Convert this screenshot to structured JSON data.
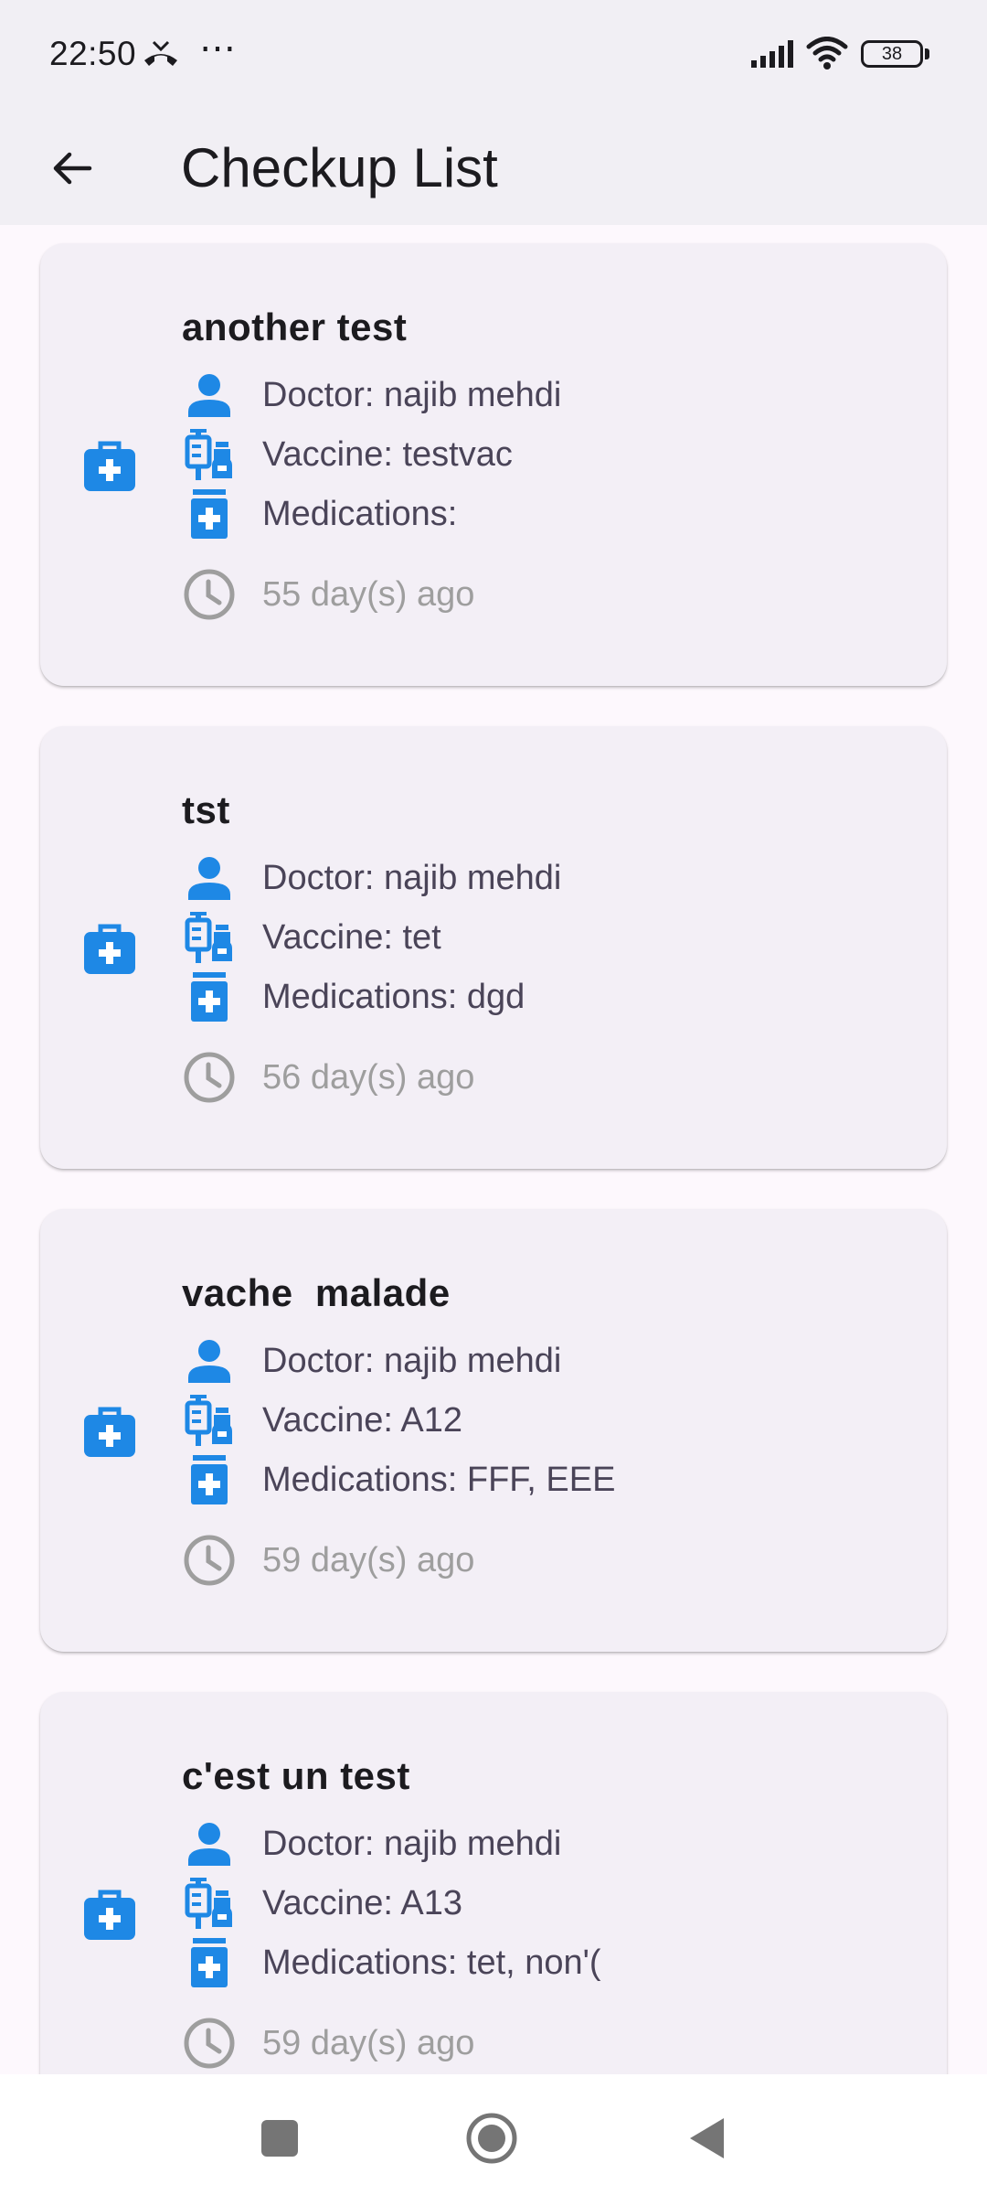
{
  "status_bar": {
    "time": "22:50",
    "dots": "⋯",
    "battery": "38"
  },
  "app_bar": {
    "title": "Checkup List"
  },
  "colors": {
    "accent": "#1e88e5",
    "muted": "#9e9e9e"
  },
  "checkups": [
    {
      "title": "another test",
      "doctor": "Doctor: najib mehdi",
      "vaccine": "Vaccine: testvac",
      "medications": "Medications:",
      "time_ago": "55 day(s) ago"
    },
    {
      "title": "tst",
      "doctor": "Doctor: najib mehdi",
      "vaccine": "Vaccine: tet",
      "medications": "Medications: dgd",
      "time_ago": "56 day(s) ago"
    },
    {
      "title": "vache  malade",
      "doctor": "Doctor: najib mehdi",
      "vaccine": "Vaccine: A12",
      "medications": "Medications: FFF, EEE",
      "time_ago": "59 day(s) ago"
    },
    {
      "title": "c'est un test",
      "doctor": "Doctor: najib mehdi",
      "vaccine": "Vaccine: A13",
      "medications": "Medications: tet, non'(",
      "time_ago": "59 day(s) ago"
    }
  ],
  "icons": {
    "card_lead": "medical-bag-icon",
    "doctor": "person-icon",
    "vaccine": "vaccine-icon",
    "medications": "medication-icon",
    "time": "clock-icon"
  }
}
